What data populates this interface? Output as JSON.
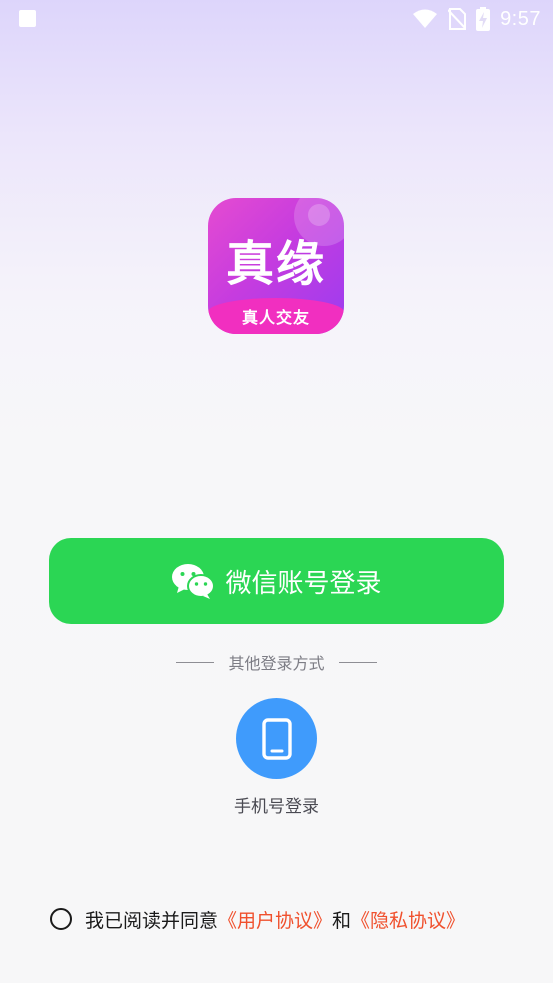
{
  "status_bar": {
    "app_icon": "A",
    "time": "9:57",
    "icons": [
      "wifi-icon",
      "no-sim-icon",
      "battery-charging-icon"
    ]
  },
  "logo": {
    "title": "真缘",
    "subtitle": "真人交友"
  },
  "wechat_login": {
    "label": "微信账号登录",
    "icon": "wechat-icon",
    "color": "#2bd654"
  },
  "other_login": {
    "divider_text": "其他登录方式",
    "phone_label": "手机号登录",
    "phone_icon": "phone-icon",
    "color": "#3f9bfc"
  },
  "agreement": {
    "prefix": "我已阅读并同意",
    "user_agreement": "《用户协议》",
    "conjunction": "和",
    "privacy_policy": "《隐私协议》",
    "link_color": "#f0502d",
    "checked": false
  }
}
